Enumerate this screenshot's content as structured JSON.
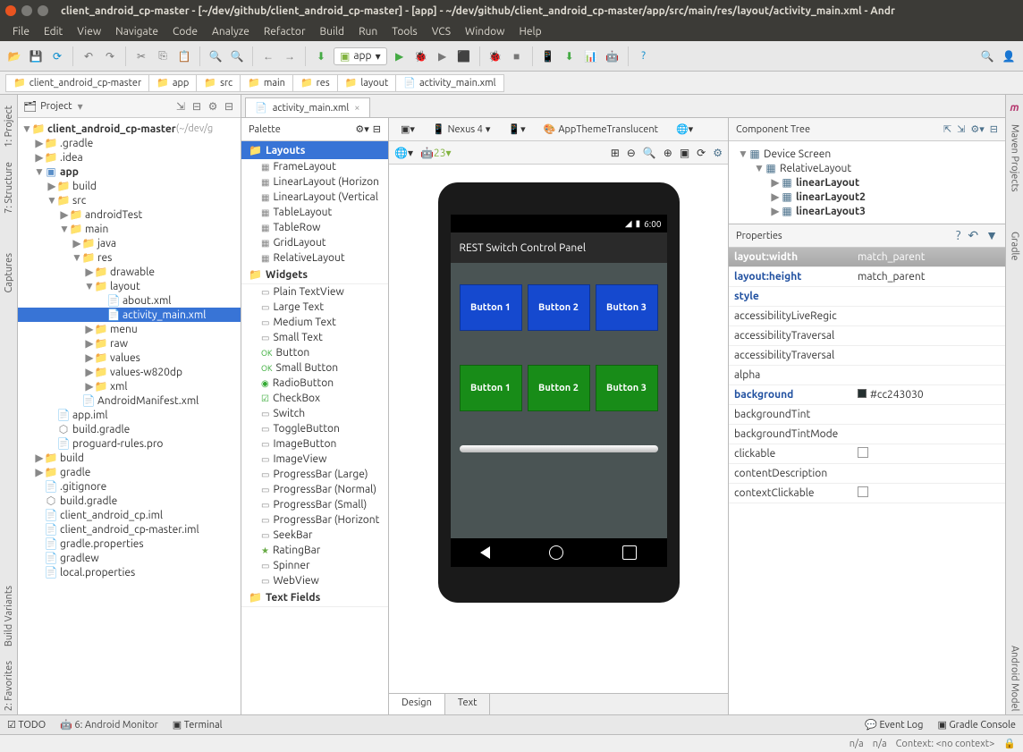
{
  "window": {
    "title": "client_android_cp-master - [~/dev/github/client_android_cp-master] - [app] - ~/dev/github/client_android_cp-master/app/src/main/res/layout/activity_main.xml - Andr"
  },
  "menubar": [
    "File",
    "Edit",
    "View",
    "Navigate",
    "Code",
    "Analyze",
    "Refactor",
    "Build",
    "Run",
    "Tools",
    "VCS",
    "Window",
    "Help"
  ],
  "toolbar": {
    "appsel": "app"
  },
  "breadcrumb": [
    "client_android_cp-master",
    "app",
    "src",
    "main",
    "res",
    "layout",
    "activity_main.xml"
  ],
  "left_tabs": [
    "1: Project",
    "7: Structure",
    "Captures",
    "Build Variants",
    "2: Favorites"
  ],
  "right_tabs": [
    "Maven Projects",
    "Gradle",
    "Android Model"
  ],
  "project": {
    "head": "Project",
    "tree": [
      {
        "ind": 0,
        "tw": "▼",
        "ic": "dir",
        "lbl": "client_android_cp-master",
        "bold": true,
        "hint": "(~/dev/g"
      },
      {
        "ind": 1,
        "tw": "▶",
        "ic": "dir",
        "lbl": ".gradle"
      },
      {
        "ind": 1,
        "tw": "▶",
        "ic": "dir",
        "lbl": ".idea"
      },
      {
        "ind": 1,
        "tw": "▼",
        "ic": "app",
        "lbl": "app",
        "bold": true
      },
      {
        "ind": 2,
        "tw": "▶",
        "ic": "dir",
        "lbl": "build"
      },
      {
        "ind": 2,
        "tw": "▼",
        "ic": "dir",
        "lbl": "src"
      },
      {
        "ind": 3,
        "tw": "▶",
        "ic": "dir",
        "lbl": "androidTest"
      },
      {
        "ind": 3,
        "tw": "▼",
        "ic": "dir",
        "lbl": "main"
      },
      {
        "ind": 4,
        "tw": "▶",
        "ic": "dir",
        "lbl": "java"
      },
      {
        "ind": 4,
        "tw": "▼",
        "ic": "dir",
        "lbl": "res"
      },
      {
        "ind": 5,
        "tw": "▶",
        "ic": "dir",
        "lbl": "drawable"
      },
      {
        "ind": 5,
        "tw": "▼",
        "ic": "dir",
        "lbl": "layout"
      },
      {
        "ind": 6,
        "tw": "",
        "ic": "xml",
        "lbl": "about.xml"
      },
      {
        "ind": 6,
        "tw": "",
        "ic": "xml",
        "lbl": "activity_main.xml",
        "sel": true
      },
      {
        "ind": 5,
        "tw": "▶",
        "ic": "dir",
        "lbl": "menu"
      },
      {
        "ind": 5,
        "tw": "▶",
        "ic": "dir",
        "lbl": "raw"
      },
      {
        "ind": 5,
        "tw": "▶",
        "ic": "dir",
        "lbl": "values"
      },
      {
        "ind": 5,
        "tw": "▶",
        "ic": "dir",
        "lbl": "values-w820dp"
      },
      {
        "ind": 5,
        "tw": "▶",
        "ic": "dir",
        "lbl": "xml"
      },
      {
        "ind": 4,
        "tw": "",
        "ic": "xml",
        "lbl": "AndroidManifest.xml"
      },
      {
        "ind": 2,
        "tw": "",
        "ic": "file",
        "lbl": "app.iml"
      },
      {
        "ind": 2,
        "tw": "",
        "ic": "gradle",
        "lbl": "build.gradle"
      },
      {
        "ind": 2,
        "tw": "",
        "ic": "file",
        "lbl": "proguard-rules.pro"
      },
      {
        "ind": 1,
        "tw": "▶",
        "ic": "dir",
        "lbl": "build"
      },
      {
        "ind": 1,
        "tw": "▶",
        "ic": "dir",
        "lbl": "gradle"
      },
      {
        "ind": 1,
        "tw": "",
        "ic": "file",
        "lbl": ".gitignore"
      },
      {
        "ind": 1,
        "tw": "",
        "ic": "gradle",
        "lbl": "build.gradle"
      },
      {
        "ind": 1,
        "tw": "",
        "ic": "file",
        "lbl": "client_android_cp.iml"
      },
      {
        "ind": 1,
        "tw": "",
        "ic": "file",
        "lbl": "client_android_cp-master.iml"
      },
      {
        "ind": 1,
        "tw": "",
        "ic": "file",
        "lbl": "gradle.properties"
      },
      {
        "ind": 1,
        "tw": "",
        "ic": "file",
        "lbl": "gradlew"
      },
      {
        "ind": 1,
        "tw": "",
        "ic": "file",
        "lbl": "local.properties"
      }
    ]
  },
  "editor": {
    "tab": "activity_main.xml",
    "palette_title": "Palette",
    "palette": {
      "cat_layouts": "Layouts",
      "layouts": [
        "FrameLayout",
        "LinearLayout (Horizon",
        "LinearLayout (Vertical",
        "TableLayout",
        "TableRow",
        "GridLayout",
        "RelativeLayout"
      ],
      "cat_widgets": "Widgets",
      "widgets": [
        "Plain TextView",
        "Large Text",
        "Medium Text",
        "Small Text",
        "Button",
        "Small Button",
        "RadioButton",
        "CheckBox",
        "Switch",
        "ToggleButton",
        "ImageButton",
        "ImageView",
        "ProgressBar (Large)",
        "ProgressBar (Normal)",
        "ProgressBar (Small)",
        "ProgressBar (Horizont",
        "SeekBar",
        "RatingBar",
        "Spinner",
        "WebView"
      ],
      "cat_textfields": "Text Fields"
    },
    "design_toolbar": {
      "device": "Nexus 4",
      "theme": "AppThemeTranslucent",
      "api": "23"
    },
    "design_tabs": [
      "Design",
      "Text"
    ],
    "phone": {
      "time": "6:00",
      "app_title": "REST Switch Control Panel",
      "row1": [
        "Button 1",
        "Button 2",
        "Button 3"
      ],
      "row2": [
        "Button 1",
        "Button 2",
        "Button 3"
      ]
    }
  },
  "component_tree": {
    "title": "Component Tree",
    "nodes": [
      {
        "ind": 0,
        "tw": "▼",
        "lbl": "Device Screen"
      },
      {
        "ind": 1,
        "tw": "▼",
        "lbl": "RelativeLayout"
      },
      {
        "ind": 2,
        "tw": "▶",
        "lbl": "linearLayout",
        "bold": true
      },
      {
        "ind": 2,
        "tw": "▶",
        "lbl": "linearLayout2",
        "bold": true
      },
      {
        "ind": 2,
        "tw": "▶",
        "lbl": "linearLayout3",
        "bold": true
      }
    ]
  },
  "properties": {
    "title": "Properties",
    "rows": [
      {
        "name": "layout:width",
        "val": "match_parent",
        "sel": true,
        "bold": true
      },
      {
        "name": "layout:height",
        "val": "match_parent",
        "bold": true
      },
      {
        "name": "style",
        "val": "",
        "bold": true
      },
      {
        "name": "accessibilityLiveRegic",
        "val": ""
      },
      {
        "name": "accessibilityTraversal",
        "val": ""
      },
      {
        "name": "accessibilityTraversal",
        "val": ""
      },
      {
        "name": "alpha",
        "val": ""
      },
      {
        "name": "background",
        "val": "#cc243030",
        "bold": true,
        "swatch": true
      },
      {
        "name": "backgroundTint",
        "val": ""
      },
      {
        "name": "backgroundTintMode",
        "val": ""
      },
      {
        "name": "clickable",
        "val": "",
        "cb": true
      },
      {
        "name": "contentDescription",
        "val": ""
      },
      {
        "name": "contextClickable",
        "val": "",
        "cb": true
      }
    ]
  },
  "bottombar": [
    "TODO",
    "6: Android Monitor",
    "Terminal"
  ],
  "bottombar_right": [
    "Event Log",
    "Gradle Console"
  ],
  "status": {
    "n1": "n/a",
    "n2": "n/a",
    "ctx": "Context: <no context>"
  }
}
